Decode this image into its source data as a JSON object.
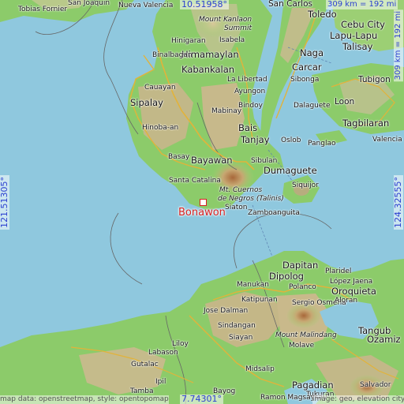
{
  "place": {
    "name": "Bonawon"
  },
  "coords": {
    "top": "10.51958°",
    "bottom": "7.74301°",
    "left": "121.51305°",
    "right": "124.32555°"
  },
  "scale": {
    "horizontal": "309 km = 192 mi",
    "vertical": "309 km = 192 mi"
  },
  "attribution": {
    "left": "map data: openstreetmap, style: opentopomap",
    "right": "image: geo, elevation city"
  },
  "colors": {
    "sea": "#8fc8de",
    "lowland": "#8ccb6a",
    "highland": "#c9b98a",
    "marker": "#d62020",
    "coords": "#2b3fd0"
  },
  "labels": [
    "Tobias Fornier",
    "San Joaquin",
    "Nueva Valencia",
    "San Carlos",
    "Toledo",
    "Cebu City",
    "Mount Kanlaon",
    "Summit",
    "Hinigaran",
    "Isabela",
    "Himamaylan",
    "Binalbagan",
    "Naga",
    "Talisay",
    "Kabankalan",
    "Carcar",
    "La Libertad",
    "Lapu-Lapu",
    "Ayungon",
    "Sibonga",
    "Tubigon",
    "Cauayan",
    "Sipalay",
    "Bindoy",
    "Dalaguete",
    "Loon",
    "Mabinay",
    "Tagbilaran",
    "Hinoba-an",
    "Bais",
    "Tanjay",
    "Oslob",
    "Panglao",
    "Valencia",
    "Basay",
    "Bayawan",
    "Sibulan",
    "Dumaguete",
    "Santa Catalina",
    "Mt. Cuernos",
    "de Negros (Talinis)",
    "Siquijor",
    "Siaton",
    "Zamboanguita",
    "Dapitan",
    "Dipolog",
    "Polanco",
    "Plaridel",
    "López Jaena",
    "Manukan",
    "Oroquieta",
    "Katipunan",
    "Sergio Osmeña",
    "Aloran",
    "Jose Dalman",
    "Sindangan",
    "Mount Malindang",
    "Tangub",
    "Siayan",
    "Molave",
    "Ozamiz",
    "Liloy",
    "Labason",
    "Gutalac",
    "Midsalip",
    "Ipil",
    "Pagadian",
    "Salvador",
    "Tukuran",
    "Bayog",
    "Tamba",
    "Ramon Magsaysay"
  ]
}
